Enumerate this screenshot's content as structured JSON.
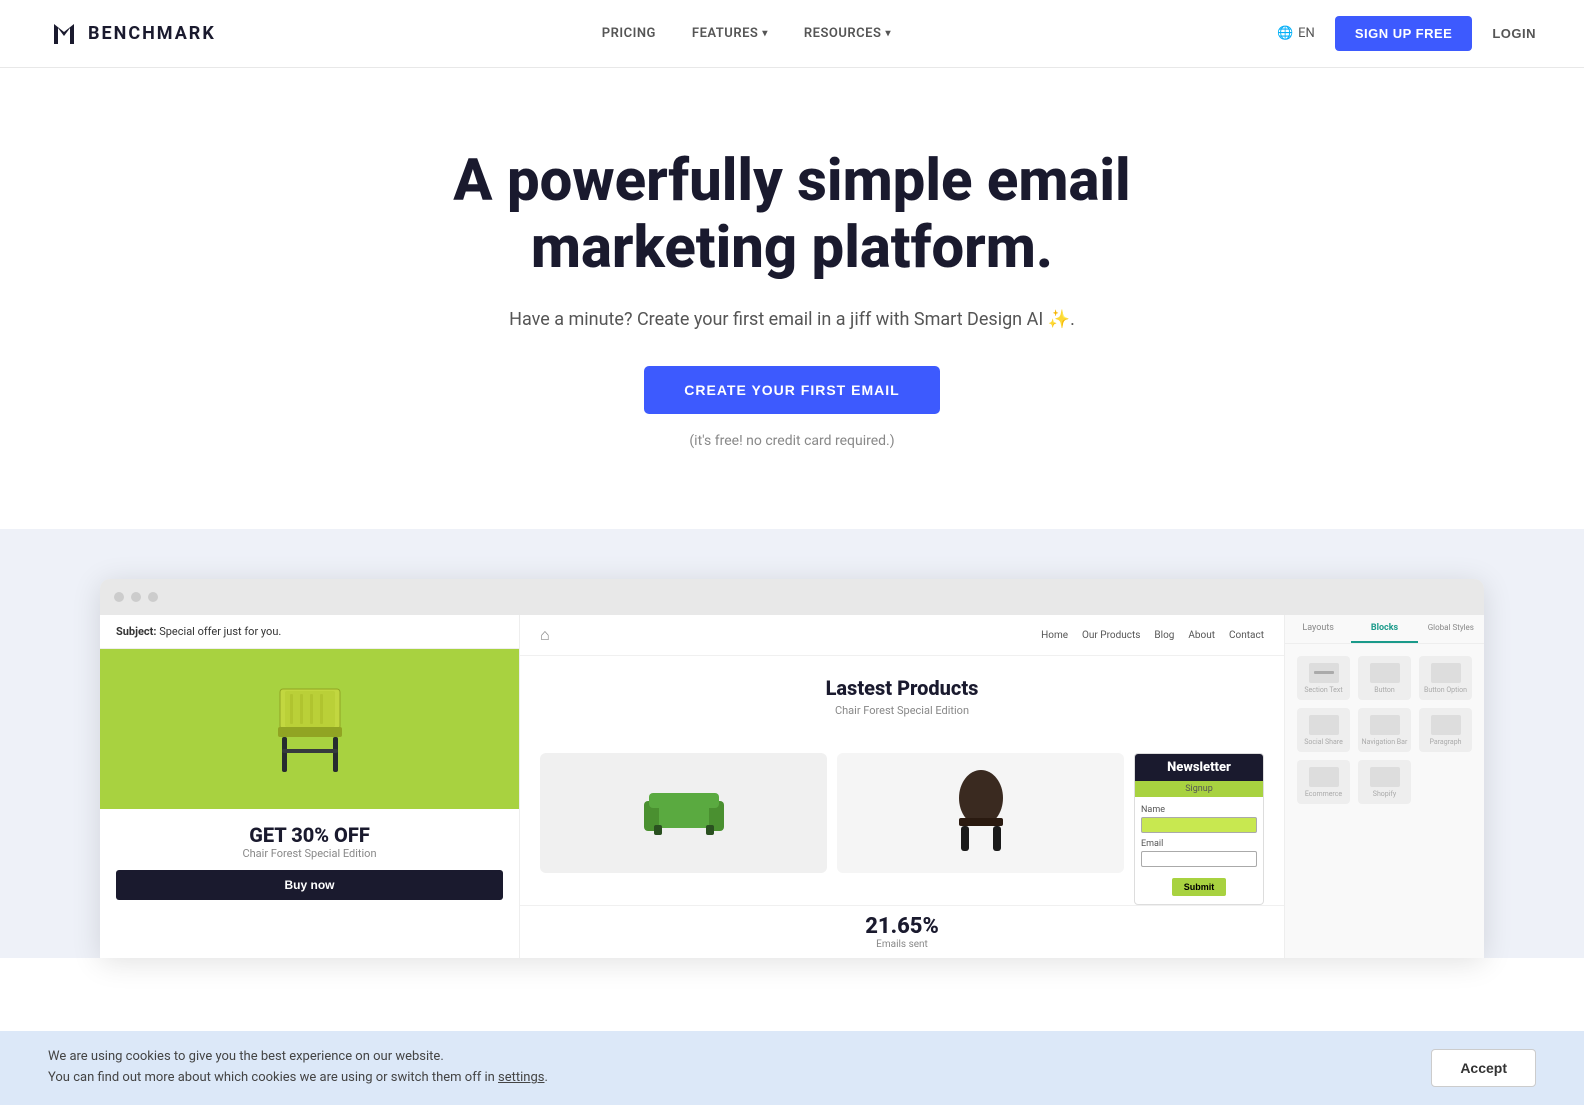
{
  "nav": {
    "logo_text": "BENCHMARK",
    "links": [
      {
        "id": "pricing",
        "label": "PRICING",
        "has_dropdown": false
      },
      {
        "id": "features",
        "label": "FEATURES",
        "has_dropdown": true
      },
      {
        "id": "resources",
        "label": "RESOURCES",
        "has_dropdown": true
      }
    ],
    "lang": "EN",
    "signup_label": "SIGN UP FREE",
    "login_label": "LOGIN"
  },
  "hero": {
    "headline_line1": "A powerfully simple email",
    "headline_line2": "marketing platform.",
    "subheading": "Have a minute? Create your first email in a jiff with Smart Design AI ✨.",
    "cta_label": "CREATE YOUR FIRST EMAIL",
    "note": "(it's free! no credit card required.)"
  },
  "preview": {
    "browser_dots": [
      "dot1",
      "dot2",
      "dot3"
    ],
    "email": {
      "subject_prefix": "Subject:",
      "subject_text": "Special offer just for you.",
      "promo_title": "GET 30% OFF",
      "promo_sub": "Chair Forest Special Edition",
      "btn_label": "Buy now"
    },
    "website": {
      "nav_items": [
        "Home",
        "Our Products",
        "Blog",
        "About",
        "Contact"
      ],
      "hero_title": "Lastest Products",
      "hero_sub": "Chair Forest Special Edition",
      "stats_number": "21.65%",
      "stats_label": "Emails sent"
    },
    "newsletter": {
      "title": "Newsletter",
      "sub": "Signup",
      "name_label": "Name",
      "email_label": "Email",
      "submit_label": "Submit"
    },
    "blocks": {
      "tabs": [
        "Layouts",
        "Blocks",
        "Global Styles"
      ],
      "active_tab": "Blocks",
      "items": [
        {
          "icon": "🖼",
          "label": "Section Text"
        },
        {
          "icon": "⬜",
          "label": "Button"
        },
        {
          "icon": "⬛",
          "label": "Button Option"
        },
        {
          "icon": "🟩",
          "label": "Social Share"
        },
        {
          "icon": "📋",
          "label": "Navigation Bar"
        },
        {
          "icon": "📄",
          "label": "Paragraph"
        },
        {
          "icon": "🛒",
          "label": "Ecommerce"
        },
        {
          "icon": "🖼",
          "label": "Shopify"
        }
      ]
    }
  },
  "cookie": {
    "text_line1": "We are using cookies to give you the best experience on our website.",
    "text_line2": "You can find out more about which cookies we are using or switch them off in",
    "settings_label": "settings",
    "text_end": ".",
    "accept_label": "Accept"
  }
}
